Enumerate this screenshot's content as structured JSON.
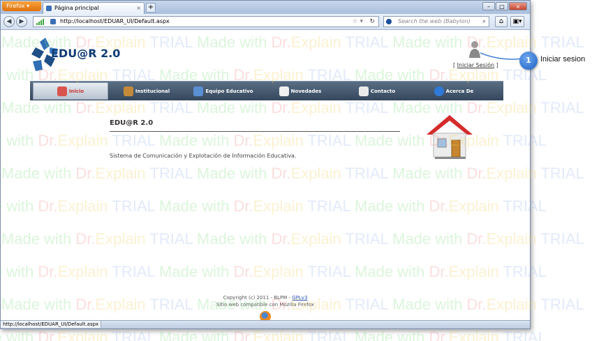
{
  "browser": {
    "app_menu_label": "Firefox",
    "tab_title": "Página principal",
    "url": "http://localhost/EDUAR_UI/Default.aspx",
    "search_placeholder": "Search the web (Babylon)",
    "status_url": "http://localhost/EDUAR_UI/Default.aspx"
  },
  "site": {
    "logo_text": "EDU@R 2.0",
    "login_prefix": "[ ",
    "login_label": "Iniciar Sesión",
    "login_suffix": " ]",
    "menu": [
      {
        "label": "Inicio",
        "active": true
      },
      {
        "label": "Institucional"
      },
      {
        "label": "Equipo Educativo"
      },
      {
        "label": "Novedades"
      },
      {
        "label": "Contacto"
      },
      {
        "label": "Acerca De"
      }
    ],
    "content_title": "EDU@R 2.0",
    "content_text": "Sistema de Comunicación y Explotación de Información Educativa.",
    "footer_copyright": "Copyright (c) 2011 - BLPM - ",
    "footer_license": "GPLv3",
    "footer_compat": "Sitio web compatible con Mozilla Firefox"
  },
  "annotation": {
    "number": "1",
    "label": "Iniciar sesion"
  },
  "watermark": {
    "made": "Made with ",
    "dr": "Dr.",
    "explain": "Explain ",
    "trial": "TRIAL"
  },
  "colors": {
    "menu_bg": "#34475c",
    "badge": "#1a5fc4",
    "link": "#2a52be"
  }
}
